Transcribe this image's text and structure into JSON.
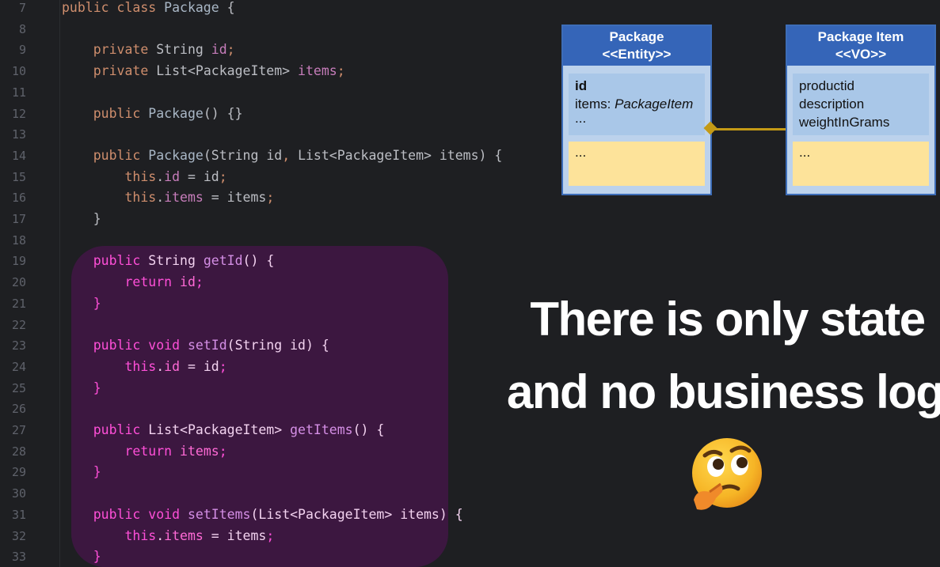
{
  "editor": {
    "lines": [
      {
        "n": "7",
        "tokens": [
          [
            "kw",
            "public class "
          ],
          [
            "fn",
            "Package"
          ],
          [
            "pl",
            " {"
          ]
        ]
      },
      {
        "n": "8",
        "tokens": []
      },
      {
        "n": "9",
        "tokens": [
          [
            "pl",
            "    "
          ],
          [
            "kw",
            "private "
          ],
          [
            "pl",
            "String "
          ],
          [
            "id",
            "id"
          ],
          [
            "kw",
            ";"
          ]
        ]
      },
      {
        "n": "10",
        "tokens": [
          [
            "pl",
            "    "
          ],
          [
            "kw",
            "private "
          ],
          [
            "pl",
            "List<PackageItem> "
          ],
          [
            "id",
            "items"
          ],
          [
            "kw",
            ";"
          ]
        ]
      },
      {
        "n": "11",
        "tokens": []
      },
      {
        "n": "12",
        "tokens": [
          [
            "pl",
            "    "
          ],
          [
            "kw",
            "public "
          ],
          [
            "fn",
            "Package"
          ],
          [
            "pl",
            "() {}"
          ]
        ]
      },
      {
        "n": "13",
        "tokens": []
      },
      {
        "n": "14",
        "tokens": [
          [
            "pl",
            "    "
          ],
          [
            "kw",
            "public "
          ],
          [
            "fn",
            "Package"
          ],
          [
            "pl",
            "(String id"
          ],
          [
            "kw",
            ", "
          ],
          [
            "pl",
            "List<PackageItem> items) {"
          ]
        ]
      },
      {
        "n": "15",
        "tokens": [
          [
            "pl",
            "        "
          ],
          [
            "kw",
            "this"
          ],
          [
            "pl",
            "."
          ],
          [
            "id",
            "id"
          ],
          [
            "pl",
            " = id"
          ],
          [
            "kw",
            ";"
          ]
        ]
      },
      {
        "n": "16",
        "tokens": [
          [
            "pl",
            "        "
          ],
          [
            "kw",
            "this"
          ],
          [
            "pl",
            "."
          ],
          [
            "id",
            "items"
          ],
          [
            "pl",
            " = items"
          ],
          [
            "kw",
            ";"
          ]
        ]
      },
      {
        "n": "17",
        "tokens": [
          [
            "pl",
            "    }"
          ]
        ]
      },
      {
        "n": "18",
        "tokens": []
      },
      {
        "n": "19",
        "hl": true,
        "tokens": [
          [
            "pl",
            "    "
          ],
          [
            "kw",
            "public "
          ],
          [
            "pl",
            "String "
          ],
          [
            "fn",
            "getId"
          ],
          [
            "pl",
            "() {"
          ]
        ]
      },
      {
        "n": "20",
        "hl": true,
        "tokens": [
          [
            "pl",
            "        "
          ],
          [
            "kw",
            "return "
          ],
          [
            "id",
            "id"
          ],
          [
            "kw",
            ";"
          ]
        ]
      },
      {
        "n": "21",
        "hl": true,
        "tokens": [
          [
            "pl",
            "    "
          ],
          [
            "br",
            "}"
          ]
        ]
      },
      {
        "n": "22",
        "hl": true,
        "tokens": []
      },
      {
        "n": "23",
        "hl": true,
        "tokens": [
          [
            "pl",
            "    "
          ],
          [
            "kw",
            "public void "
          ],
          [
            "fn",
            "setId"
          ],
          [
            "pl",
            "(String id) {"
          ]
        ]
      },
      {
        "n": "24",
        "hl": true,
        "tokens": [
          [
            "pl",
            "        "
          ],
          [
            "kw",
            "this"
          ],
          [
            "pl",
            "."
          ],
          [
            "id",
            "id"
          ],
          [
            "pl",
            " = id"
          ],
          [
            "kw",
            ";"
          ]
        ]
      },
      {
        "n": "25",
        "hl": true,
        "tokens": [
          [
            "pl",
            "    "
          ],
          [
            "br",
            "}"
          ]
        ]
      },
      {
        "n": "26",
        "hl": true,
        "tokens": []
      },
      {
        "n": "27",
        "hl": true,
        "tokens": [
          [
            "pl",
            "    "
          ],
          [
            "kw",
            "public "
          ],
          [
            "pl",
            "List<PackageItem> "
          ],
          [
            "fn",
            "getItems"
          ],
          [
            "pl",
            "() {"
          ]
        ]
      },
      {
        "n": "28",
        "hl": true,
        "tokens": [
          [
            "pl",
            "        "
          ],
          [
            "kw",
            "return "
          ],
          [
            "id",
            "items"
          ],
          [
            "kw",
            ";"
          ]
        ]
      },
      {
        "n": "29",
        "hl": true,
        "tokens": [
          [
            "pl",
            "    "
          ],
          [
            "br",
            "}"
          ]
        ]
      },
      {
        "n": "30",
        "hl": true,
        "tokens": []
      },
      {
        "n": "31",
        "hl": true,
        "tokens": [
          [
            "pl",
            "    "
          ],
          [
            "kw",
            "public void "
          ],
          [
            "fn",
            "setItems"
          ],
          [
            "pl",
            "(List<PackageItem> items) {"
          ]
        ]
      },
      {
        "n": "32",
        "hl": true,
        "tokens": [
          [
            "pl",
            "        "
          ],
          [
            "kw",
            "this"
          ],
          [
            "pl",
            "."
          ],
          [
            "id",
            "items"
          ],
          [
            "pl",
            " = items"
          ],
          [
            "kw",
            ";"
          ]
        ]
      },
      {
        "n": "33",
        "hl": true,
        "tokens": [
          [
            "pl",
            "    "
          ],
          [
            "br",
            "}"
          ]
        ]
      }
    ]
  },
  "uml": {
    "package": {
      "name": "Package",
      "stereotype": "<<Entity>>",
      "attr_id": "id",
      "attr_items_prefix": "items: ",
      "attr_items_type": "PackageItem",
      "attr_more": "...",
      "ops": "..."
    },
    "package_item": {
      "name": "Package Item",
      "stereotype": "<<VO>>",
      "attrs": [
        "productid",
        "description",
        "weightInGrams"
      ],
      "ops": "..."
    }
  },
  "headline": {
    "line1": "There is only state",
    "line2": "and no business logic"
  },
  "emoji": {
    "name": "thinking-face-icon"
  },
  "colors": {
    "highlight": "#3c1740",
    "uml_header": "#3565b8",
    "uml_attrs": "#a9c7e8",
    "uml_ops": "#fde39a",
    "connector": "#c49a16"
  }
}
